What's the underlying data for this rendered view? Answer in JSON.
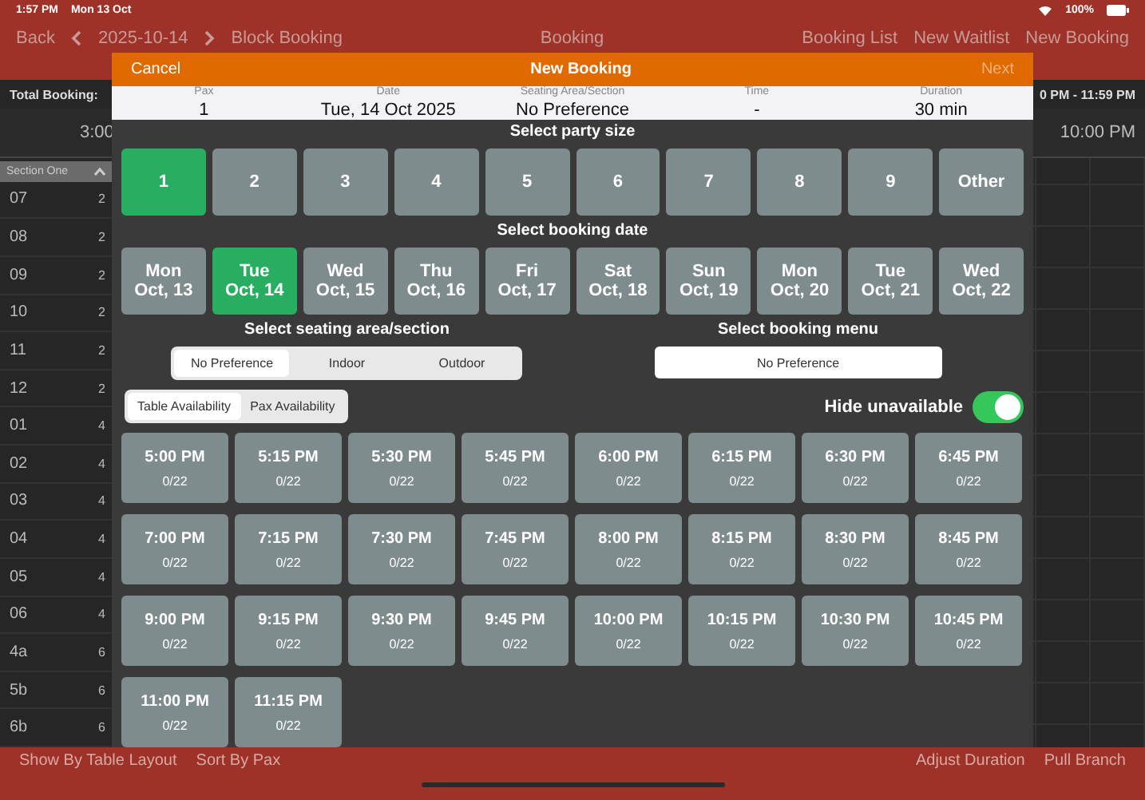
{
  "status_bar": {
    "time": "1:57 PM",
    "date": "Mon 13 Oct",
    "battery": "100%"
  },
  "nav": {
    "back": "Back",
    "date": "2025-10-14",
    "block_booking": "Block Booking",
    "title": "Booking",
    "links": [
      "Booking List",
      "New Waitlist",
      "New Booking"
    ]
  },
  "summary_bar": {
    "total": "Total Booking:",
    "range": "0 PM - 11:59 PM"
  },
  "timeline": {
    "start": "3:00",
    "end": "10:00 PM"
  },
  "sections": {
    "title": "Section One",
    "rows": [
      {
        "name": "07",
        "pax": "2"
      },
      {
        "name": "08",
        "pax": "2"
      },
      {
        "name": "09",
        "pax": "2"
      },
      {
        "name": "10",
        "pax": "2"
      },
      {
        "name": "11",
        "pax": "2"
      },
      {
        "name": "12",
        "pax": "2"
      },
      {
        "name": "01",
        "pax": "4"
      },
      {
        "name": "02",
        "pax": "4"
      },
      {
        "name": "03",
        "pax": "4"
      },
      {
        "name": "04",
        "pax": "4"
      },
      {
        "name": "05",
        "pax": "4"
      },
      {
        "name": "06",
        "pax": "4"
      },
      {
        "name": "4a",
        "pax": "6"
      },
      {
        "name": "5b",
        "pax": "6"
      },
      {
        "name": "6b",
        "pax": "6"
      }
    ]
  },
  "bottom_bar": {
    "left": [
      "Show By Table Layout",
      "Sort By Pax"
    ],
    "right": [
      "Adjust Duration",
      "Pull Branch"
    ]
  },
  "modal": {
    "cancel": "Cancel",
    "title": "New Booking",
    "next": {
      "label": "Next",
      "disabled": true
    },
    "summary": [
      {
        "label": "Pax",
        "value": "1"
      },
      {
        "label": "Date",
        "value": "Tue, 14 Oct 2025"
      },
      {
        "label": "Seating Area/Section",
        "value": "No Preference"
      },
      {
        "label": "Time",
        "value": "-"
      },
      {
        "label": "Duration",
        "value": "30 min"
      }
    ],
    "party_title": "Select party size",
    "party": [
      {
        "label": "1",
        "selected": true
      },
      {
        "label": "2",
        "selected": false
      },
      {
        "label": "3",
        "selected": false
      },
      {
        "label": "4",
        "selected": false
      },
      {
        "label": "5",
        "selected": false
      },
      {
        "label": "6",
        "selected": false
      },
      {
        "label": "7",
        "selected": false
      },
      {
        "label": "8",
        "selected": false
      },
      {
        "label": "9",
        "selected": false
      },
      {
        "label": "Other",
        "selected": false
      }
    ],
    "date_title": "Select booking date",
    "dates": [
      {
        "day": "Mon",
        "date": "Oct, 13",
        "selected": false
      },
      {
        "day": "Tue",
        "date": "Oct, 14",
        "selected": true
      },
      {
        "day": "Wed",
        "date": "Oct, 15",
        "selected": false
      },
      {
        "day": "Thu",
        "date": "Oct, 16",
        "selected": false
      },
      {
        "day": "Fri",
        "date": "Oct, 17",
        "selected": false
      },
      {
        "day": "Sat",
        "date": "Oct, 18",
        "selected": false
      },
      {
        "day": "Sun",
        "date": "Oct, 19",
        "selected": false
      },
      {
        "day": "Mon",
        "date": "Oct, 20",
        "selected": false
      },
      {
        "day": "Tue",
        "date": "Oct, 21",
        "selected": false
      },
      {
        "day": "Wed",
        "date": "Oct, 22",
        "selected": false
      }
    ],
    "seating_title": "Select seating area/section",
    "seating": [
      {
        "label": "No Preference",
        "selected": true
      },
      {
        "label": "Indoor",
        "selected": false
      },
      {
        "label": "Outdoor",
        "selected": false
      }
    ],
    "menu_title": "Select booking menu",
    "menu_value": "No Preference",
    "availability": [
      {
        "label": "Table Availability",
        "selected": true
      },
      {
        "label": "Pax Availability",
        "selected": false
      }
    ],
    "hide_unavailable": {
      "label": "Hide unavailable",
      "on": true
    },
    "times": [
      {
        "time": "5:00 PM",
        "count": "0/22"
      },
      {
        "time": "5:15 PM",
        "count": "0/22"
      },
      {
        "time": "5:30 PM",
        "count": "0/22"
      },
      {
        "time": "5:45 PM",
        "count": "0/22"
      },
      {
        "time": "6:00 PM",
        "count": "0/22"
      },
      {
        "time": "6:15 PM",
        "count": "0/22"
      },
      {
        "time": "6:30 PM",
        "count": "0/22"
      },
      {
        "time": "6:45 PM",
        "count": "0/22"
      },
      {
        "time": "7:00 PM",
        "count": "0/22"
      },
      {
        "time": "7:15 PM",
        "count": "0/22"
      },
      {
        "time": "7:30 PM",
        "count": "0/22"
      },
      {
        "time": "7:45 PM",
        "count": "0/22"
      },
      {
        "time": "8:00 PM",
        "count": "0/22"
      },
      {
        "time": "8:15 PM",
        "count": "0/22"
      },
      {
        "time": "8:30 PM",
        "count": "0/22"
      },
      {
        "time": "8:45 PM",
        "count": "0/22"
      },
      {
        "time": "9:00 PM",
        "count": "0/22"
      },
      {
        "time": "9:15 PM",
        "count": "0/22"
      },
      {
        "time": "9:30 PM",
        "count": "0/22"
      },
      {
        "time": "9:45 PM",
        "count": "0/22"
      },
      {
        "time": "10:00 PM",
        "count": "0/22"
      },
      {
        "time": "10:15 PM",
        "count": "0/22"
      },
      {
        "time": "10:30 PM",
        "count": "0/22"
      },
      {
        "time": "10:45 PM",
        "count": "0/22"
      },
      {
        "time": "11:00 PM",
        "count": "0/22"
      },
      {
        "time": "11:15 PM",
        "count": "0/22"
      }
    ]
  }
}
